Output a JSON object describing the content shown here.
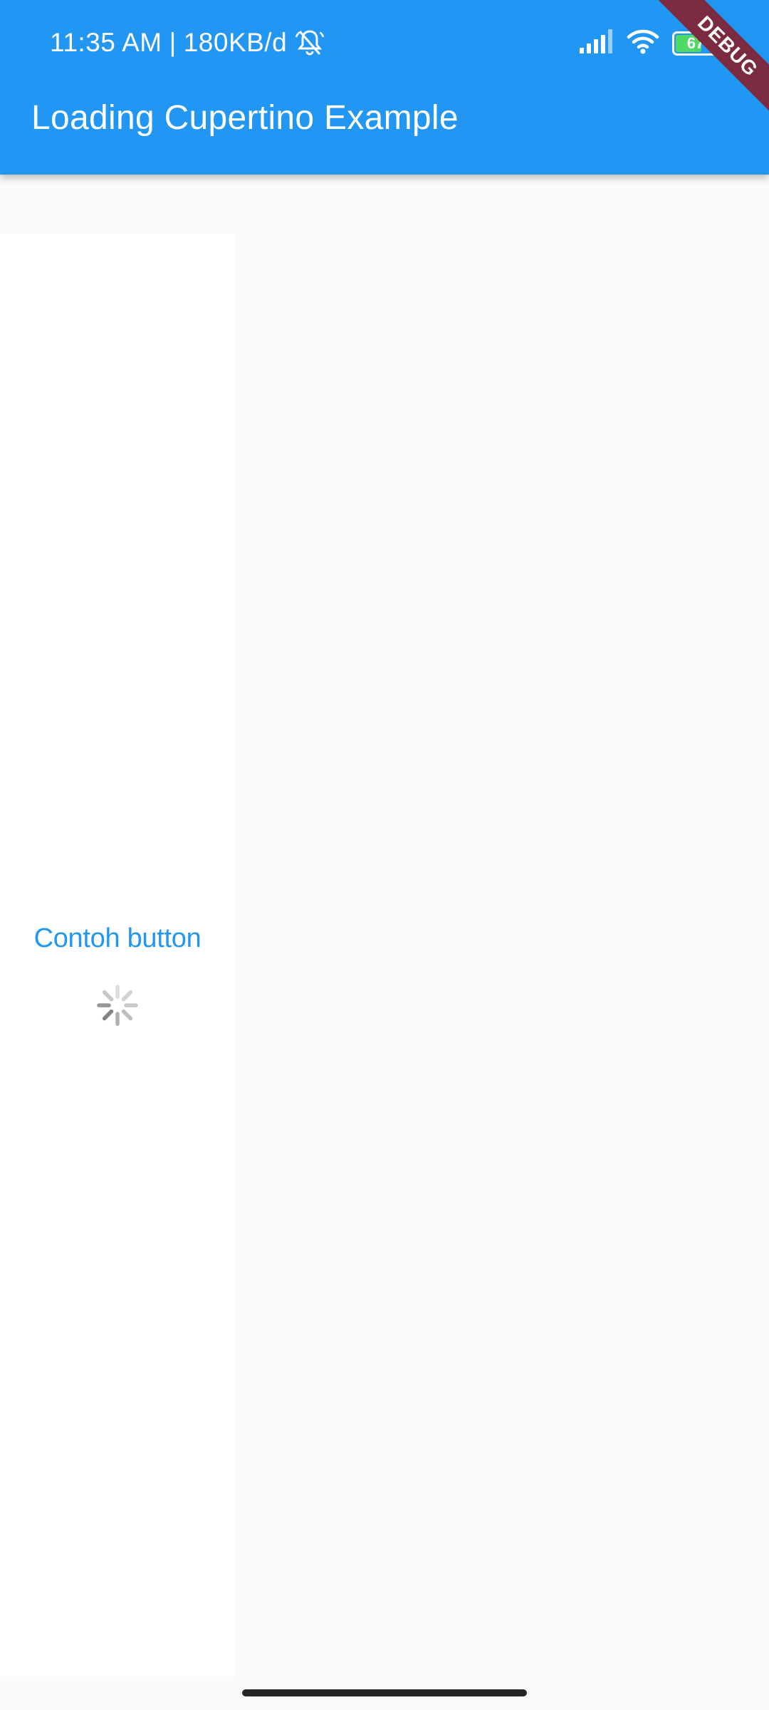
{
  "status_bar": {
    "time": "11:35 AM",
    "separator": "|",
    "data_rate": "180KB/d",
    "icons": [
      "bell-off-icon",
      "signal-icon",
      "wifi-icon",
      "battery-icon"
    ],
    "battery_level": "67",
    "battery_fraction": 0.67
  },
  "app_bar": {
    "title": "Loading Cupertino Example",
    "color": "#2196f3"
  },
  "debug_banner": {
    "label": "DEBUG",
    "color": "#7a2b40"
  },
  "content": {
    "button_label": "Contoh button",
    "button_color": "#2196f3",
    "loading_indicator": "cupertino-activity-indicator-icon"
  }
}
